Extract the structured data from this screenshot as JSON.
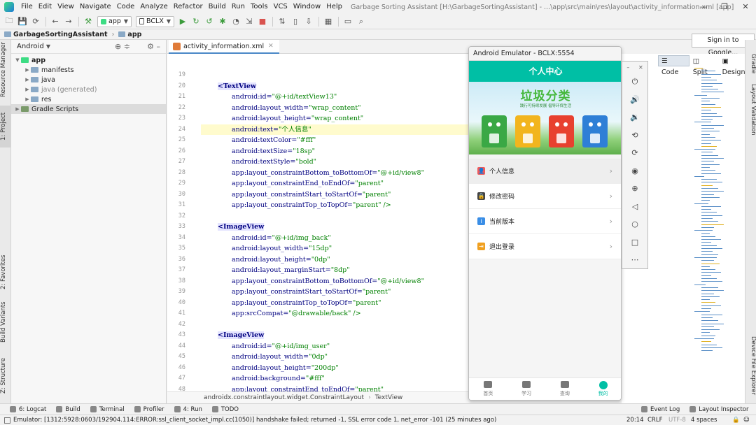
{
  "menu": [
    "File",
    "Edit",
    "View",
    "Navigate",
    "Code",
    "Analyze",
    "Refactor",
    "Build",
    "Run",
    "Tools",
    "VCS",
    "Window",
    "Help"
  ],
  "window_title": "Garbage Sorting Assistant [H:\\GarbageSortingAssistant] - ...\\app\\src\\main\\res\\layout\\activity_information.xml [app]",
  "toolbar": {
    "run_config": "app",
    "device": "BCLX"
  },
  "breadcrumb": {
    "project": "GarbageSortingAssistant",
    "module": "app"
  },
  "left_tabs": [
    "Resource Manager",
    "1: Project",
    "2: Favorites",
    "Build Variants",
    "Z: Structure"
  ],
  "project_panel": {
    "view": "Android",
    "tree": [
      {
        "label": "app",
        "level": 0
      },
      {
        "label": "manifests",
        "level": 1
      },
      {
        "label": "java",
        "level": 1
      },
      {
        "label": "java (generated)",
        "level": 1
      },
      {
        "label": "res",
        "level": 1
      },
      {
        "label": "Gradle Scripts",
        "level": 0
      }
    ]
  },
  "editor": {
    "tab": "activity_information.xml",
    "footer": {
      "parent": "androidx.constraintlayout.widget.ConstraintLayout",
      "child": "TextView"
    },
    "lines": [
      {
        "n": "19",
        "i": 0,
        "a": "",
        "v": "",
        "t": ""
      },
      {
        "n": "20",
        "i": 1,
        "t": "<TextView"
      },
      {
        "n": "21",
        "i": 2,
        "a": "android:id=",
        "v": "\"@+id/textView13\""
      },
      {
        "n": "22",
        "i": 2,
        "a": "android:layout_width=",
        "v": "\"wrap_content\""
      },
      {
        "n": "23",
        "i": 2,
        "a": "android:layout_height=",
        "v": "\"wrap_content\""
      },
      {
        "n": "24",
        "i": 2,
        "a": "android:text=",
        "v": "\"个人信息\"",
        "hl": true
      },
      {
        "n": "25",
        "i": 2,
        "a": "android:textColor=",
        "v": "\"#fff\""
      },
      {
        "n": "26",
        "i": 2,
        "a": "android:textSize=",
        "v": "\"18sp\""
      },
      {
        "n": "27",
        "i": 2,
        "a": "android:textStyle=",
        "v": "\"bold\""
      },
      {
        "n": "28",
        "i": 2,
        "a": "app:layout_constraintBottom_toBottomOf=",
        "v": "\"@+id/view8\""
      },
      {
        "n": "29",
        "i": 2,
        "a": "app:layout_constraintEnd_toEndOf=",
        "v": "\"parent\""
      },
      {
        "n": "30",
        "i": 2,
        "a": "app:layout_constraintStart_toStartOf=",
        "v": "\"parent\""
      },
      {
        "n": "31",
        "i": 2,
        "a": "app:layout_constraintTop_toTopOf=",
        "v": "\"parent\" />"
      },
      {
        "n": "32",
        "i": 0,
        "a": "",
        "v": ""
      },
      {
        "n": "33",
        "i": 1,
        "t": "<ImageView"
      },
      {
        "n": "34",
        "i": 2,
        "a": "android:id=",
        "v": "\"@+id/img_back\""
      },
      {
        "n": "35",
        "i": 2,
        "a": "android:layout_width=",
        "v": "\"15dp\""
      },
      {
        "n": "36",
        "i": 2,
        "a": "android:layout_height=",
        "v": "\"0dp\""
      },
      {
        "n": "37",
        "i": 2,
        "a": "android:layout_marginStart=",
        "v": "\"8dp\""
      },
      {
        "n": "38",
        "i": 2,
        "a": "app:layout_constraintBottom_toBottomOf=",
        "v": "\"@+id/view8\""
      },
      {
        "n": "39",
        "i": 2,
        "a": "app:layout_constraintStart_toStartOf=",
        "v": "\"parent\""
      },
      {
        "n": "40",
        "i": 2,
        "a": "app:layout_constraintTop_toTopOf=",
        "v": "\"parent\""
      },
      {
        "n": "41",
        "i": 2,
        "a": "app:srcCompat=",
        "v": "\"@drawable/back\" />"
      },
      {
        "n": "42",
        "i": 0,
        "a": "",
        "v": ""
      },
      {
        "n": "43",
        "i": 1,
        "t": "<ImageView"
      },
      {
        "n": "44",
        "i": 2,
        "a": "android:id=",
        "v": "\"@+id/img_user\""
      },
      {
        "n": "45",
        "i": 2,
        "a": "android:layout_width=",
        "v": "\"0dp\""
      },
      {
        "n": "46",
        "i": 2,
        "a": "android:layout_height=",
        "v": "\"200dp\""
      },
      {
        "n": "47",
        "i": 2,
        "a": "android:background=",
        "v": "\"#fff\""
      },
      {
        "n": "48",
        "i": 2,
        "a": "app:layout_constraintEnd_toEndOf=",
        "v": "\"parent\""
      }
    ]
  },
  "view_modes": [
    "Code",
    "Split",
    "Design"
  ],
  "signin_label": "Sign in to Google...",
  "right_tabs": [
    "Gradle",
    "Layout Validation",
    "Device File Explorer"
  ],
  "emulator": {
    "title": "Android Emulator - BCLX:5554",
    "app_title": "个人中心",
    "banner_title": "垃圾分类",
    "banner_subtitle": "践行可持续发展 倡导环保生活",
    "menu": [
      {
        "label": "个人信息",
        "color": "#f05a5a"
      },
      {
        "label": "修改密码",
        "color": "#444444"
      },
      {
        "label": "当前版本",
        "color": "#3a8ee6"
      },
      {
        "label": "退出登录",
        "color": "#f0a020"
      }
    ],
    "nav": [
      {
        "label": "首页"
      },
      {
        "label": "学习"
      },
      {
        "label": "查询"
      },
      {
        "label": "我的"
      }
    ]
  },
  "bottom_tools": [
    {
      "label": "6: Logcat"
    },
    {
      "label": "Build"
    },
    {
      "label": "Terminal"
    },
    {
      "label": "Profiler"
    },
    {
      "label": "4: Run"
    },
    {
      "label": "TODO"
    }
  ],
  "bottom_right_tools": [
    {
      "label": "Event Log"
    },
    {
      "label": "Layout Inspector"
    }
  ],
  "status": {
    "message": "Emulator: [1312:5928:0603/192904.114:ERROR:ssl_client_socket_impl.cc(1050)] handshake failed; returned -1, SSL error code 1, net_error -101 (25 minutes ago)",
    "position": "20:14",
    "line_sep": "CRLF",
    "encoding": "UTF-8",
    "indent": "4 spaces"
  }
}
